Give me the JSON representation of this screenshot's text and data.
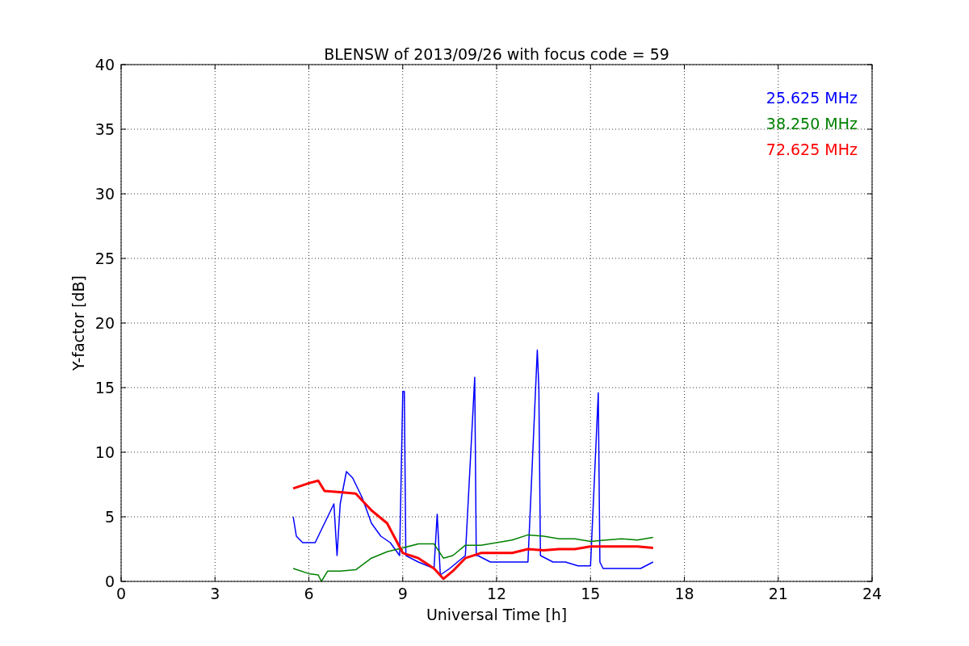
{
  "chart_data": {
    "type": "line",
    "grid": true,
    "title": "BLENSW of 2013/09/26 with focus code = 59",
    "xlabel": "Universal Time [h]",
    "ylabel": "Y-factor [dB]",
    "xlim": [
      0,
      24
    ],
    "ylim": [
      0,
      40
    ],
    "xticks": [
      0,
      3,
      6,
      9,
      12,
      15,
      18,
      21,
      24
    ],
    "yticks": [
      0,
      5,
      10,
      15,
      20,
      25,
      30,
      35,
      40
    ],
    "series": [
      {
        "name": "25.625 MHz",
        "color": "#0000ff",
        "x": [
          5.5,
          5.6,
          5.8,
          6.0,
          6.2,
          6.5,
          6.8,
          6.9,
          7.0,
          7.2,
          7.4,
          7.7,
          8.0,
          8.3,
          8.6,
          8.9,
          9.0,
          9.05,
          9.1,
          9.5,
          10.0,
          10.1,
          10.2,
          10.5,
          11.0,
          11.3,
          11.35,
          11.4,
          11.8,
          12.2,
          12.6,
          13.0,
          13.3,
          13.35,
          13.4,
          13.8,
          14.2,
          14.6,
          15.0,
          15.25,
          15.3,
          15.4,
          15.8,
          16.2,
          16.6,
          17.0
        ],
        "values": [
          5,
          3.5,
          3,
          3,
          3,
          4.5,
          6,
          2,
          6,
          8.5,
          8,
          6.5,
          4.5,
          3.5,
          3,
          2,
          14.7,
          14.7,
          2,
          1.5,
          1,
          5.2,
          0.5,
          1,
          2,
          15.8,
          2,
          2,
          1.5,
          1.5,
          1.5,
          1.5,
          17.9,
          15,
          2,
          1.5,
          1.5,
          1.2,
          1.2,
          14.6,
          1.5,
          1,
          1,
          1,
          1,
          1.5
        ]
      },
      {
        "name": "38.250 MHz",
        "color": "#008000",
        "x": [
          5.5,
          6,
          6.3,
          6.4,
          6.6,
          7,
          7.5,
          8,
          8.5,
          9,
          9.5,
          10,
          10.3,
          10.6,
          11,
          11.5,
          12,
          12.5,
          13,
          13.5,
          14,
          14.5,
          15,
          15.5,
          16,
          16.5,
          17
        ],
        "values": [
          1,
          0.6,
          0.5,
          0,
          0.8,
          0.8,
          0.9,
          1.8,
          2.3,
          2.6,
          2.9,
          2.9,
          1.8,
          2,
          2.8,
          2.8,
          3,
          3.2,
          3.6,
          3.5,
          3.3,
          3.3,
          3.1,
          3.2,
          3.3,
          3.2,
          3.4
        ]
      },
      {
        "name": "72.625 MHz",
        "color": "#ff0000",
        "x": [
          5.5,
          6,
          6.3,
          6.5,
          7,
          7.5,
          8,
          8.5,
          9,
          9.5,
          10,
          10.3,
          10.6,
          11,
          11.5,
          12,
          12.5,
          13,
          13.5,
          14,
          14.5,
          15,
          15.5,
          16,
          16.5,
          17
        ],
        "values": [
          7.2,
          7.6,
          7.8,
          7,
          6.9,
          6.8,
          5.5,
          4.5,
          2.2,
          1.8,
          1,
          0.2,
          0.8,
          1.8,
          2.2,
          2.2,
          2.2,
          2.5,
          2.4,
          2.5,
          2.5,
          2.7,
          2.7,
          2.7,
          2.7,
          2.6
        ]
      }
    ]
  }
}
